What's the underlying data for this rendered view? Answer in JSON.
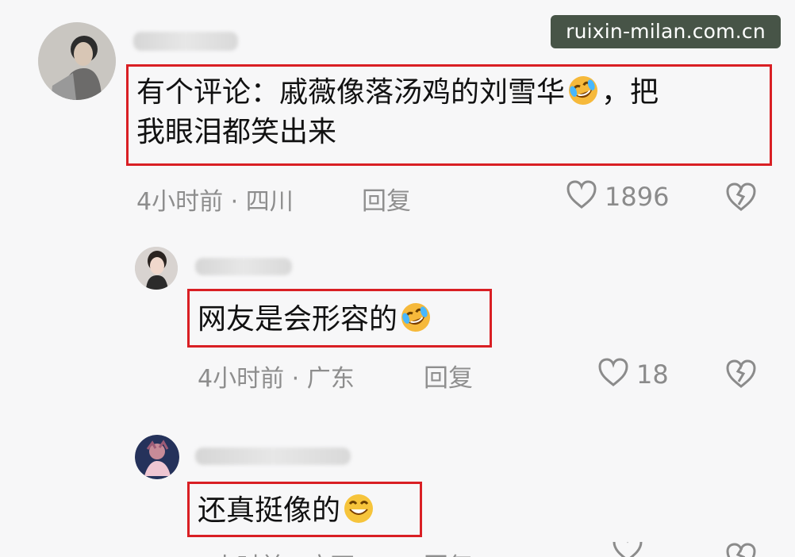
{
  "watermark": "ruixin-milan.com.cn",
  "comments": [
    {
      "text_line_1": "有个评论：戚薇像落汤鸡的刘雪华",
      "text_line_2_prefix": "，把",
      "text_line_3": "我眼泪都笑出来",
      "meta": "4小时前 · 四川",
      "reply": "回复",
      "likes": "1896",
      "emoji": "rolling-laugh-emoji"
    },
    {
      "text": "网友是会形容的",
      "meta": "4小时前 · 广东",
      "reply": "回复",
      "likes": "18",
      "emoji": "rolling-laugh-emoji"
    },
    {
      "text": "还真挺像的",
      "meta": "",
      "reply": "",
      "likes": "",
      "emoji": "grinning-face-emoji"
    }
  ],
  "icons": {
    "heart": "heart-icon",
    "broken_heart": "broken-heart-icon"
  },
  "colors": {
    "highlight_border": "#d91f24",
    "muted_text": "#8d8d8d",
    "watermark_bg": "#2f3e2d"
  }
}
